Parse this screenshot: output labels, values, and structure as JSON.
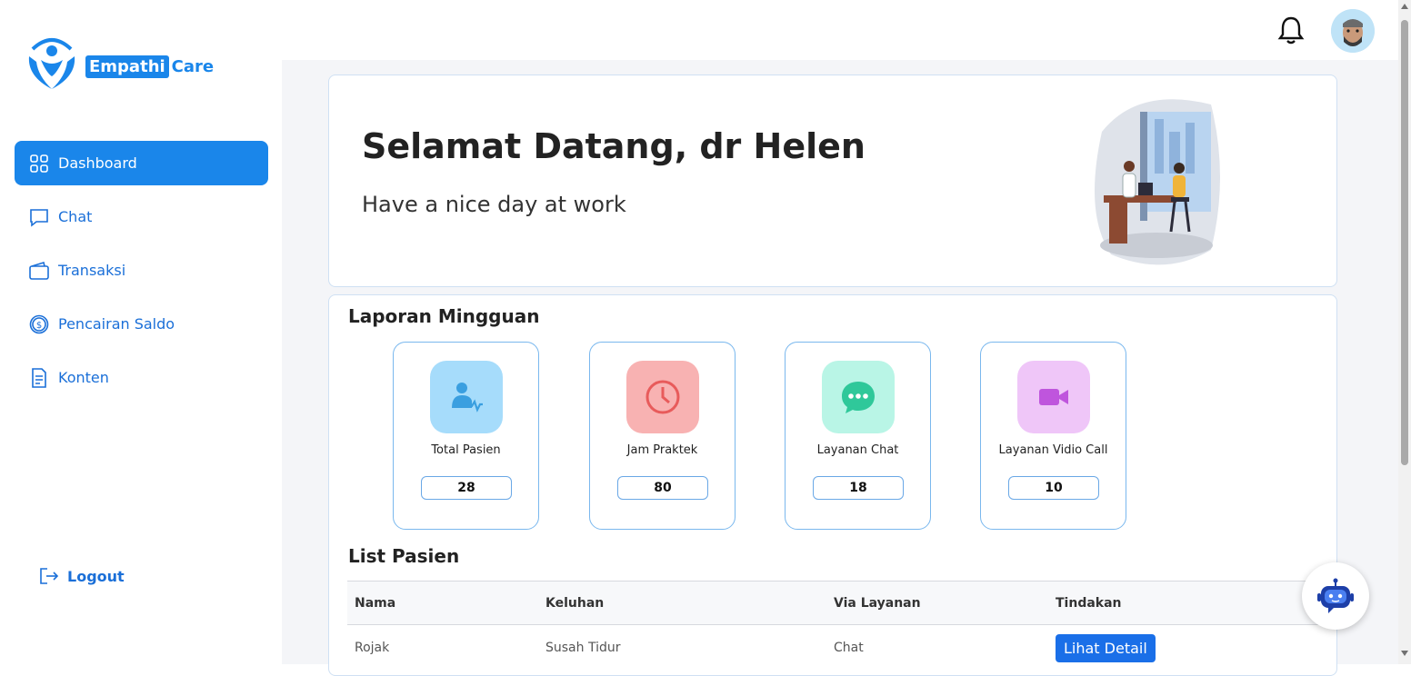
{
  "brand": {
    "part1": "Empathi",
    "part2": "Care",
    "color": "#1a86ea"
  },
  "sidebar": {
    "items": [
      {
        "label": "Dashboard",
        "icon": "grid-icon",
        "active": true
      },
      {
        "label": "Chat",
        "icon": "chat-bubble-icon",
        "active": false
      },
      {
        "label": "Transaksi",
        "icon": "wallet-icon",
        "active": false
      },
      {
        "label": "Pencairan Saldo",
        "icon": "dollar-coin-icon",
        "active": false
      },
      {
        "label": "Konten",
        "icon": "document-icon",
        "active": false
      }
    ],
    "logout_label": "Logout"
  },
  "header": {
    "bell_icon": "bell-icon",
    "avatar_icon": "user-avatar"
  },
  "welcome": {
    "title": "Selamat Datang, dr Helen",
    "subtitle": "Have a nice day at work"
  },
  "report": {
    "title": "Laporan Mingguan",
    "stats": [
      {
        "label": "Total Pasien",
        "value": "28",
        "icon": "patient-icon",
        "bg": "#a6dcfb",
        "fg": "#3a9fe0"
      },
      {
        "label": "Jam Praktek",
        "value": "80",
        "icon": "clock-icon",
        "bg": "#f8b2b2",
        "fg": "#e85b5b"
      },
      {
        "label": "Layanan Chat",
        "value": "18",
        "icon": "chat-dots-icon",
        "bg": "#b9f5e6",
        "fg": "#2fc89a"
      },
      {
        "label": "Layanan Vidio Call",
        "value": "10",
        "icon": "video-camera-icon",
        "bg": "#efc6f8",
        "fg": "#bf55dd"
      }
    ]
  },
  "patients": {
    "title": "List Pasien",
    "columns": [
      "Nama",
      "Keluhan",
      "Via Layanan",
      "Tindakan"
    ],
    "rows": [
      {
        "nama": "Rojak",
        "keluhan": "Susah Tidur",
        "via": "Chat",
        "action": "Lihat Detail"
      }
    ]
  },
  "chatbot": {
    "icon": "robot-icon"
  }
}
